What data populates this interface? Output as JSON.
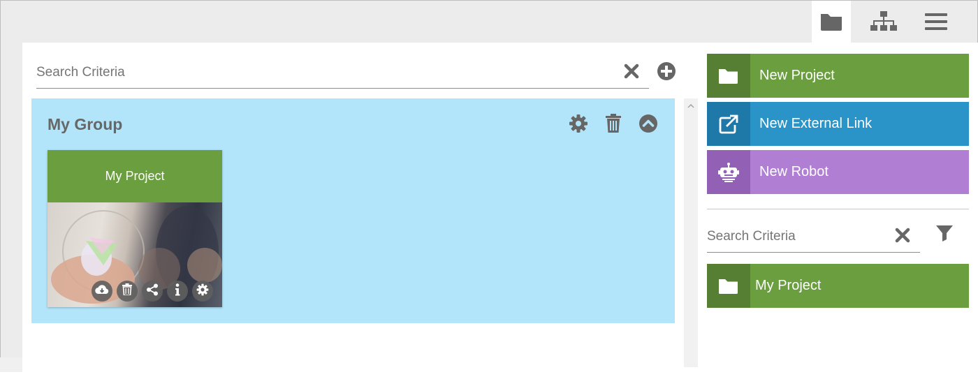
{
  "toolbar": {
    "buttons": [
      {
        "icon": "folder-icon",
        "active": true
      },
      {
        "icon": "sitemap-icon",
        "active": false
      },
      {
        "icon": "menu-icon",
        "active": false
      }
    ]
  },
  "left_search": {
    "placeholder": "Search Criteria",
    "value": ""
  },
  "group": {
    "title": "My Group",
    "actions": [
      "gear-icon",
      "trash-icon",
      "chevron-up-circle-icon"
    ],
    "cards": [
      {
        "title": "My Project",
        "header_color": "#6a9e3f",
        "actions": [
          "cloud-download-icon",
          "trash-icon",
          "share-icon",
          "info-icon",
          "gear-icon"
        ]
      }
    ]
  },
  "right_panel": {
    "create_buttons": [
      {
        "label": "New Project",
        "icon": "folder-icon",
        "color": "#6a9e3f",
        "icon_bg": "#567f33"
      },
      {
        "label": "New External Link",
        "icon": "external-link-icon",
        "color": "#2a94c9",
        "icon_bg": "#1f79a8"
      },
      {
        "label": "New Robot",
        "icon": "robot-icon",
        "color": "#b07fd3",
        "icon_bg": "#9260b4"
      }
    ],
    "search": {
      "placeholder": "Search Criteria",
      "value": ""
    },
    "results": [
      {
        "label": "My Project",
        "icon": "folder-icon",
        "color": "#6a9e3f",
        "icon_bg": "#567f33"
      }
    ]
  },
  "colors": {
    "group_bg": "#b3e5fa",
    "page_bg": "#ececec",
    "icon_gray": "#666666"
  }
}
